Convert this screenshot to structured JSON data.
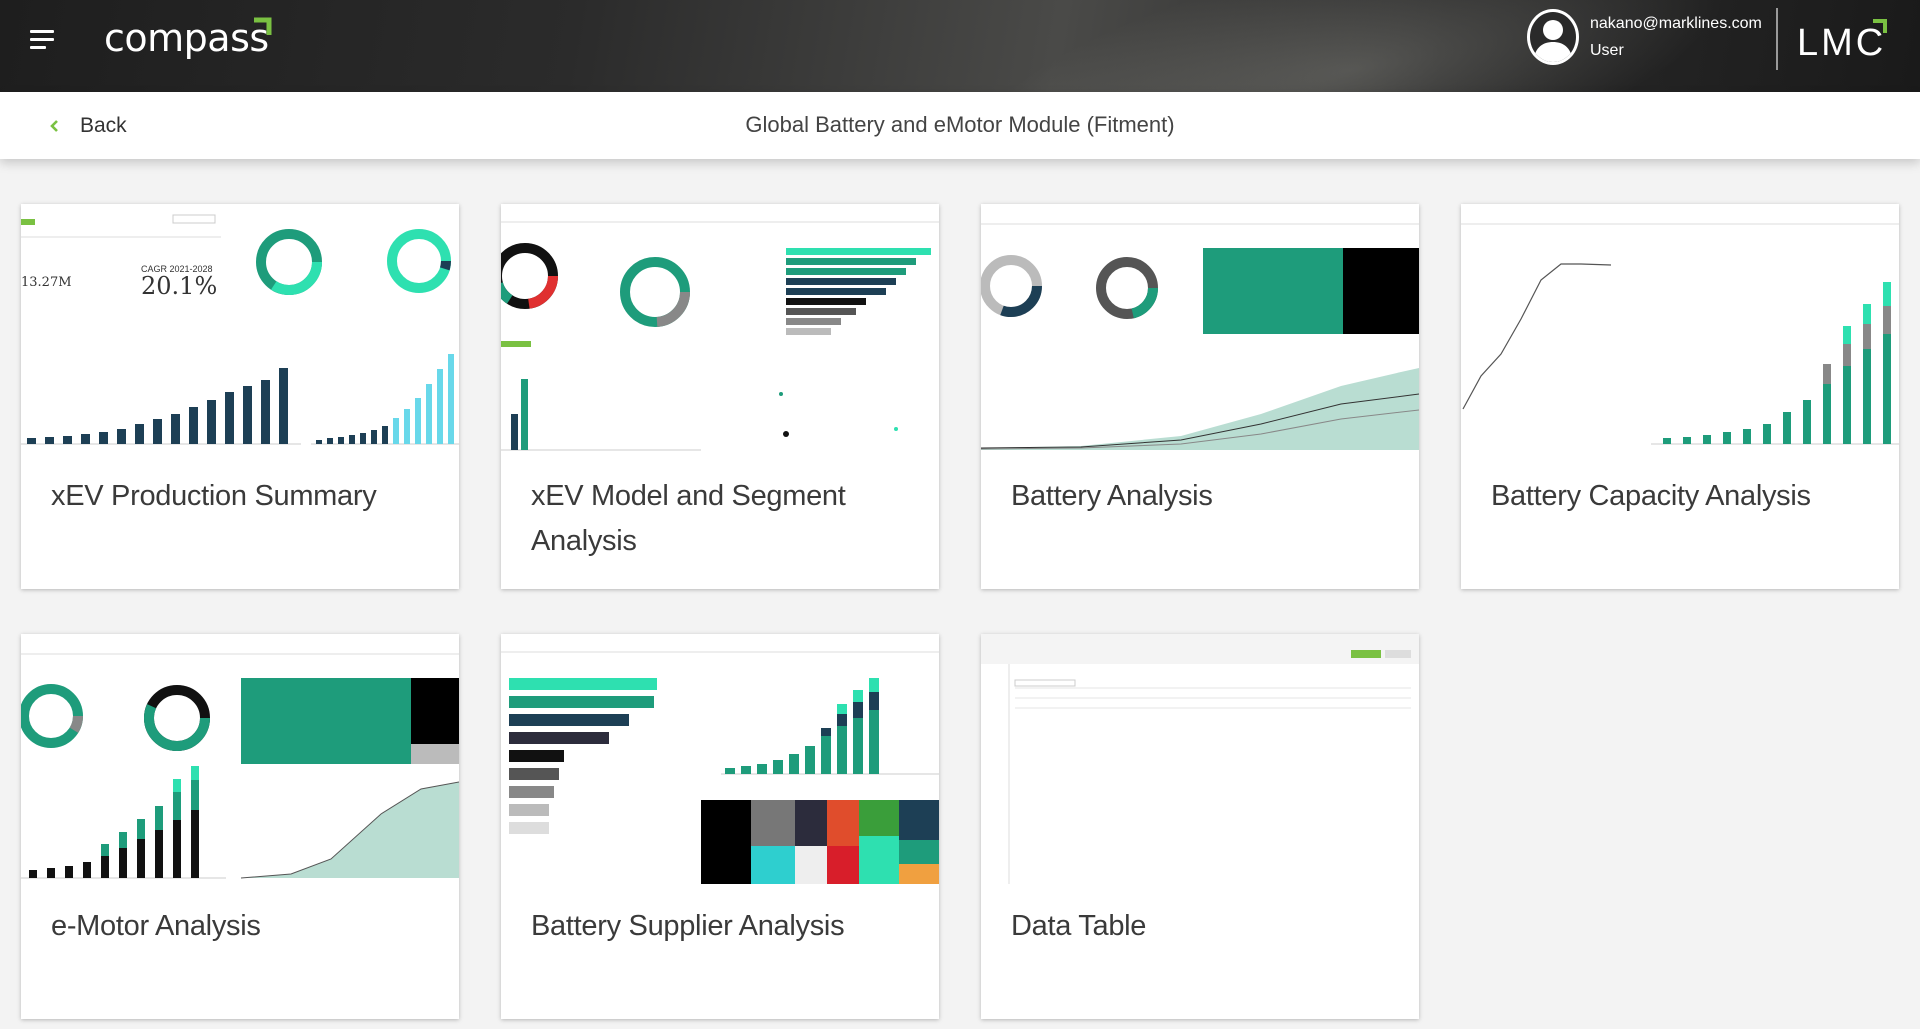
{
  "header": {
    "logo_text": "compass",
    "user_email": "nakano@marklines.com",
    "user_role": "User",
    "brand_text": "LMC",
    "accent_color": "#7ac142"
  },
  "subheader": {
    "back_label": "Back",
    "title": "Global Battery and eMotor Module (Fitment)"
  },
  "cards": [
    {
      "title": "xEV Production Summary",
      "thumb_kpi_1": "13.27M",
      "thumb_kpi_2": "20.1%",
      "thumb_kpi_2_label": "CAGR 2021-2028"
    },
    {
      "title": "xEV Model and Segment Analysis"
    },
    {
      "title": "Battery Analysis"
    },
    {
      "title": "Battery Capacity Analysis"
    },
    {
      "title": "e-Motor Analysis"
    },
    {
      "title": "Battery Supplier Analysis"
    },
    {
      "title": "Data Table"
    }
  ],
  "colors": {
    "teal": "#1e9c7b",
    "mint": "#2ee0b0",
    "navy": "#1d3f55",
    "cyan": "#68d8ea",
    "green": "#7ac142"
  }
}
